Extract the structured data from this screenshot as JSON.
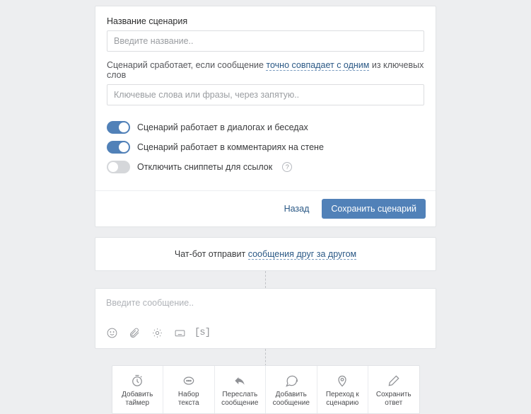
{
  "scenario": {
    "title_label": "Название сценария",
    "title_placeholder": "Введите название..",
    "trigger_hint_pre": "Сценарий сработает, если сообщение ",
    "trigger_mode": "точно совпадает с одним",
    "trigger_hint_post": " из ключевых слов",
    "keywords_placeholder": "Ключевые слова или фразы, через запятую..",
    "toggles": {
      "dialogs": {
        "label": "Сценарий работает в диалогах и беседах",
        "on": true
      },
      "comments": {
        "label": "Сценарий работает в комментариях на стене",
        "on": true
      },
      "snippets": {
        "label": "Отключить сниппеты для ссылок",
        "on": false
      }
    },
    "back": "Назад",
    "save": "Сохранить сценарий"
  },
  "bot_info": {
    "prefix": "Чат-бот отправит ",
    "mode": "сообщения друг за другом"
  },
  "message": {
    "placeholder": "Введите сообщение.."
  },
  "actions": {
    "timer": {
      "l1": "Добавить",
      "l2": "таймер"
    },
    "typing": {
      "l1": "Набор",
      "l2": "текста"
    },
    "forward": {
      "l1": "Переслать",
      "l2": "сообщение"
    },
    "add_msg": {
      "l1": "Добавить",
      "l2": "сообщение"
    },
    "goto": {
      "l1": "Переход к",
      "l2": "сценарию"
    },
    "save": {
      "l1": "Сохранить",
      "l2": "ответ"
    }
  }
}
